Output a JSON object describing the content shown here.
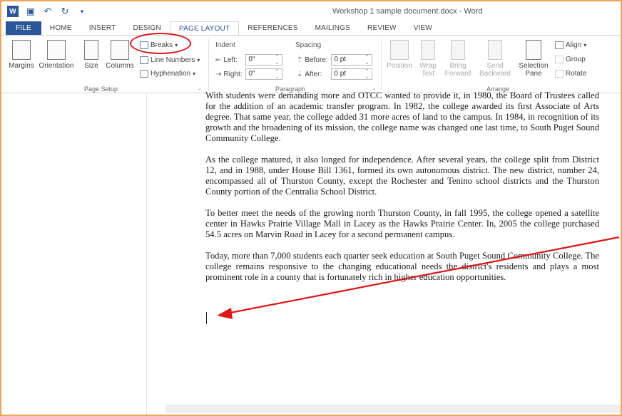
{
  "window": {
    "title": "Workshop 1 sample document.docx - Word"
  },
  "tabs": [
    {
      "label": "FILE"
    },
    {
      "label": "HOME"
    },
    {
      "label": "INSERT"
    },
    {
      "label": "DESIGN"
    },
    {
      "label": "PAGE LAYOUT"
    },
    {
      "label": "REFERENCES"
    },
    {
      "label": "MAILINGS"
    },
    {
      "label": "REVIEW"
    },
    {
      "label": "VIEW"
    }
  ],
  "ribbon": {
    "page_setup": {
      "margins": "Margins",
      "orientation": "Orientation",
      "size": "Size",
      "columns": "Columns",
      "breaks": "Breaks",
      "line_numbers": "Line Numbers",
      "hyphenation": "Hyphenation",
      "group_label": "Page Setup"
    },
    "paragraph": {
      "indent_label": "Indent",
      "spacing_label": "Spacing",
      "left_label": "Left:",
      "left_value": "0\"",
      "right_label": "Right:",
      "right_value": "0\"",
      "before_label": "Before:",
      "before_value": "0 pt",
      "after_label": "After:",
      "after_value": "0 pt",
      "group_label": "Paragraph"
    },
    "arrange": {
      "position": "Position",
      "wrap_text": "Wrap Text",
      "bring_forward": "Bring Forward",
      "send_backward": "Send Backward",
      "selection_pane": "Selection Pane",
      "align": "Align",
      "group": "Group",
      "rotate": "Rotate",
      "group_label": "Arrange"
    }
  },
  "document": {
    "paragraphs": [
      "With students were demanding more and OTCC wanted to provide it, in 1980, the Board of Trustees called for the addition of an academic transfer program.  In 1982, the college awarded its first Associate of Arts degree.  That same year, the college added 31 more acres of land to the campus.  In 1984, in recognition of its growth and the broadening of its mission, the college name was changed one last time, to South Puget Sound Community College.",
      "As the college matured, it also longed for independence.  After several years, the college split from District 12, and in 1988, under House Bill 1361, formed its own autonomous district.  The new district, number 24, encompassed all of Thurston County, except the Rochester and Tenino school districts and the Thurston County portion of the Centralia School District.",
      "To better meet the needs of the growing north Thurston County, in fall 1995, the college opened a satellite center in Hawks Prairie Village Mall in Lacey as the Hawks Prairie Center. In, 2005 the college purchased 54.5 acres on Marvin Road in Lacey for a second permanent campus.",
      "Today, more than 7,000 students each quarter seek education at South Puget Sound Community College.  The college remains responsive to the changing educational needs the district's residents and plays a most prominent role in a county that is fortunately rich in higher education opportunities."
    ]
  },
  "colors": {
    "accent": "#2b579a",
    "annotation": "#e01414",
    "frame": "#f0a45a"
  }
}
